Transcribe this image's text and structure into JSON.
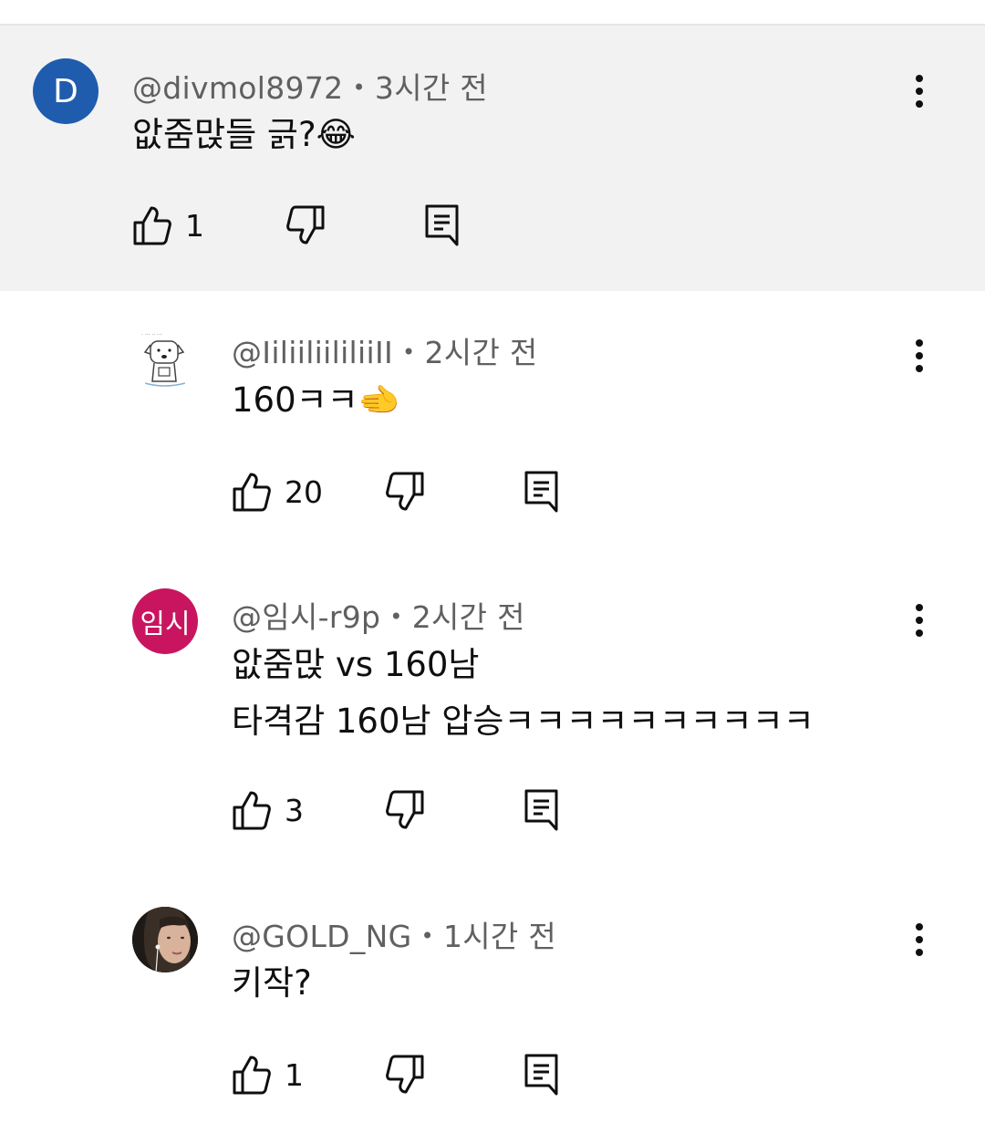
{
  "comments": [
    {
      "id": "c1",
      "avatar": {
        "type": "letter",
        "text": "D"
      },
      "handle": "@divmol8972",
      "separator": "•",
      "time": "3시간 전",
      "lines": [
        "앖줌맍들 긁?😂"
      ],
      "likes": "1"
    },
    {
      "id": "c2",
      "avatar": {
        "type": "image",
        "description": "sketch-dog"
      },
      "handle": "@IiliiliililiiII",
      "separator": "•",
      "time": "2시간 전",
      "lines": [
        "160ㅋㅋ🫲"
      ],
      "likes": "20"
    },
    {
      "id": "c3",
      "avatar": {
        "type": "letter",
        "text": "임시"
      },
      "handle": "@임시-r9p",
      "separator": "•",
      "time": "2시간 전",
      "lines": [
        "앖줌맍 vs 160남",
        "타격감 160남 압승ㅋㅋㅋㅋㅋㅋㅋㅋㅋㅋ"
      ],
      "likes": "3"
    },
    {
      "id": "c4",
      "avatar": {
        "type": "image",
        "description": "photo-person"
      },
      "handle": "@GOLD_NG",
      "separator": "•",
      "time": "1시간 전",
      "lines": [
        "키작?"
      ],
      "likes": "1"
    }
  ],
  "icons": {
    "more": "more-vert-icon",
    "like": "thumb-up-icon",
    "dislike": "thumb-down-icon",
    "reply": "reply-comment-icon"
  },
  "colors": {
    "highlight_bg": "#f2f2f2",
    "meta_text": "#606060",
    "avatar_d": "#1f5cae",
    "avatar_korean": "#c9155f"
  }
}
